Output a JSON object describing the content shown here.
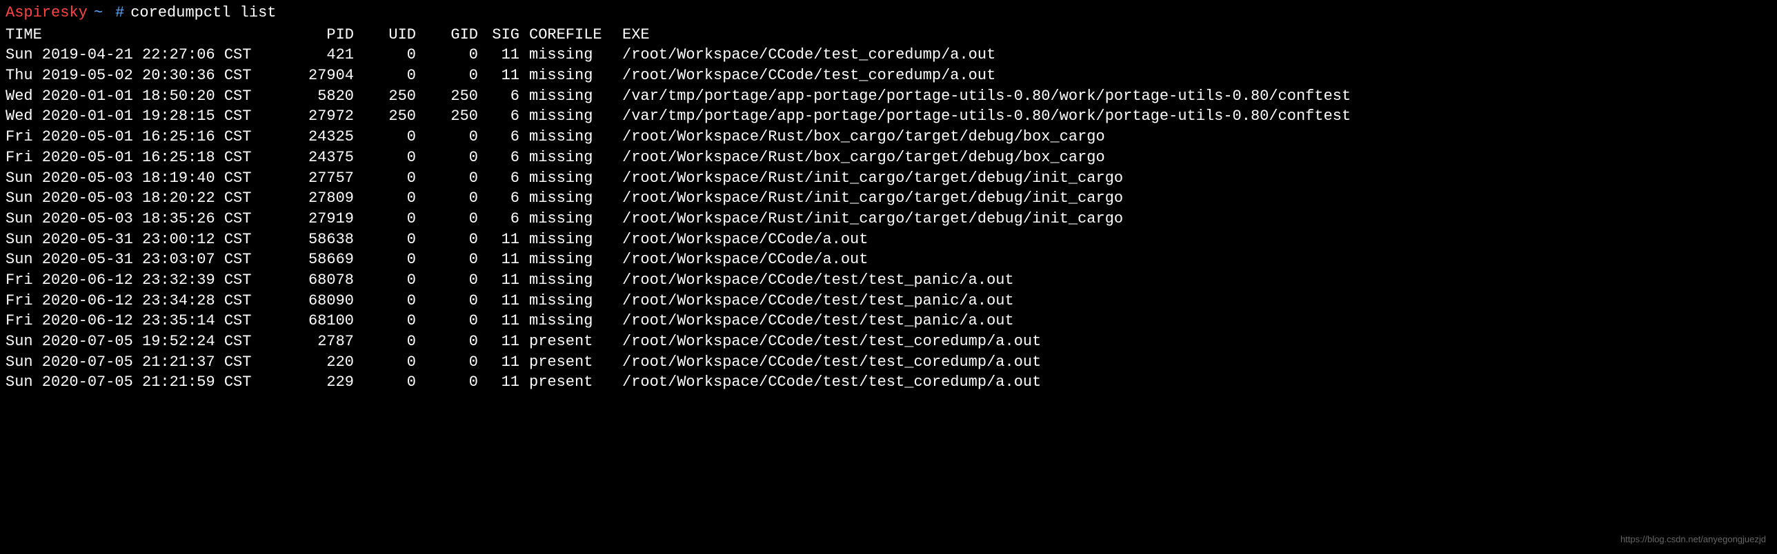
{
  "prompt": {
    "hostname": "Aspiresky",
    "tilde": "~",
    "hash": "#",
    "command": "coredumpctl list"
  },
  "headers": {
    "time": "TIME",
    "pid": "PID",
    "uid": "UID",
    "gid": "GID",
    "sig": "SIG",
    "corefile": "COREFILE",
    "exe": "EXE"
  },
  "rows": [
    {
      "time": "Sun 2019-04-21 22:27:06 CST",
      "pid": "421",
      "uid": "0",
      "gid": "0",
      "sig": "11",
      "core": "missing",
      "exe": "/root/Workspace/CCode/test_coredump/a.out"
    },
    {
      "time": "Thu 2019-05-02 20:30:36 CST",
      "pid": "27904",
      "uid": "0",
      "gid": "0",
      "sig": "11",
      "core": "missing",
      "exe": "/root/Workspace/CCode/test_coredump/a.out"
    },
    {
      "time": "Wed 2020-01-01 18:50:20 CST",
      "pid": "5820",
      "uid": "250",
      "gid": "250",
      "sig": "6",
      "core": "missing",
      "exe": "/var/tmp/portage/app-portage/portage-utils-0.80/work/portage-utils-0.80/conftest"
    },
    {
      "time": "Wed 2020-01-01 19:28:15 CST",
      "pid": "27972",
      "uid": "250",
      "gid": "250",
      "sig": "6",
      "core": "missing",
      "exe": "/var/tmp/portage/app-portage/portage-utils-0.80/work/portage-utils-0.80/conftest"
    },
    {
      "time": "Fri 2020-05-01 16:25:16 CST",
      "pid": "24325",
      "uid": "0",
      "gid": "0",
      "sig": "6",
      "core": "missing",
      "exe": "/root/Workspace/Rust/box_cargo/target/debug/box_cargo"
    },
    {
      "time": "Fri 2020-05-01 16:25:18 CST",
      "pid": "24375",
      "uid": "0",
      "gid": "0",
      "sig": "6",
      "core": "missing",
      "exe": "/root/Workspace/Rust/box_cargo/target/debug/box_cargo"
    },
    {
      "time": "Sun 2020-05-03 18:19:40 CST",
      "pid": "27757",
      "uid": "0",
      "gid": "0",
      "sig": "6",
      "core": "missing",
      "exe": "/root/Workspace/Rust/init_cargo/target/debug/init_cargo"
    },
    {
      "time": "Sun 2020-05-03 18:20:22 CST",
      "pid": "27809",
      "uid": "0",
      "gid": "0",
      "sig": "6",
      "core": "missing",
      "exe": "/root/Workspace/Rust/init_cargo/target/debug/init_cargo"
    },
    {
      "time": "Sun 2020-05-03 18:35:26 CST",
      "pid": "27919",
      "uid": "0",
      "gid": "0",
      "sig": "6",
      "core": "missing",
      "exe": "/root/Workspace/Rust/init_cargo/target/debug/init_cargo"
    },
    {
      "time": "Sun 2020-05-31 23:00:12 CST",
      "pid": "58638",
      "uid": "0",
      "gid": "0",
      "sig": "11",
      "core": "missing",
      "exe": "/root/Workspace/CCode/a.out"
    },
    {
      "time": "Sun 2020-05-31 23:03:07 CST",
      "pid": "58669",
      "uid": "0",
      "gid": "0",
      "sig": "11",
      "core": "missing",
      "exe": "/root/Workspace/CCode/a.out"
    },
    {
      "time": "Fri 2020-06-12 23:32:39 CST",
      "pid": "68078",
      "uid": "0",
      "gid": "0",
      "sig": "11",
      "core": "missing",
      "exe": "/root/Workspace/CCode/test/test_panic/a.out"
    },
    {
      "time": "Fri 2020-06-12 23:34:28 CST",
      "pid": "68090",
      "uid": "0",
      "gid": "0",
      "sig": "11",
      "core": "missing",
      "exe": "/root/Workspace/CCode/test/test_panic/a.out"
    },
    {
      "time": "Fri 2020-06-12 23:35:14 CST",
      "pid": "68100",
      "uid": "0",
      "gid": "0",
      "sig": "11",
      "core": "missing",
      "exe": "/root/Workspace/CCode/test/test_panic/a.out"
    },
    {
      "time": "Sun 2020-07-05 19:52:24 CST",
      "pid": "2787",
      "uid": "0",
      "gid": "0",
      "sig": "11",
      "core": "present",
      "exe": "/root/Workspace/CCode/test/test_coredump/a.out"
    },
    {
      "time": "Sun 2020-07-05 21:21:37 CST",
      "pid": "220",
      "uid": "0",
      "gid": "0",
      "sig": "11",
      "core": "present",
      "exe": "/root/Workspace/CCode/test/test_coredump/a.out"
    },
    {
      "time": "Sun 2020-07-05 21:21:59 CST",
      "pid": "229",
      "uid": "0",
      "gid": "0",
      "sig": "11",
      "core": "present",
      "exe": "/root/Workspace/CCode/test/test_coredump/a.out"
    }
  ],
  "watermark": "https://blog.csdn.net/anyegongjuezjd"
}
